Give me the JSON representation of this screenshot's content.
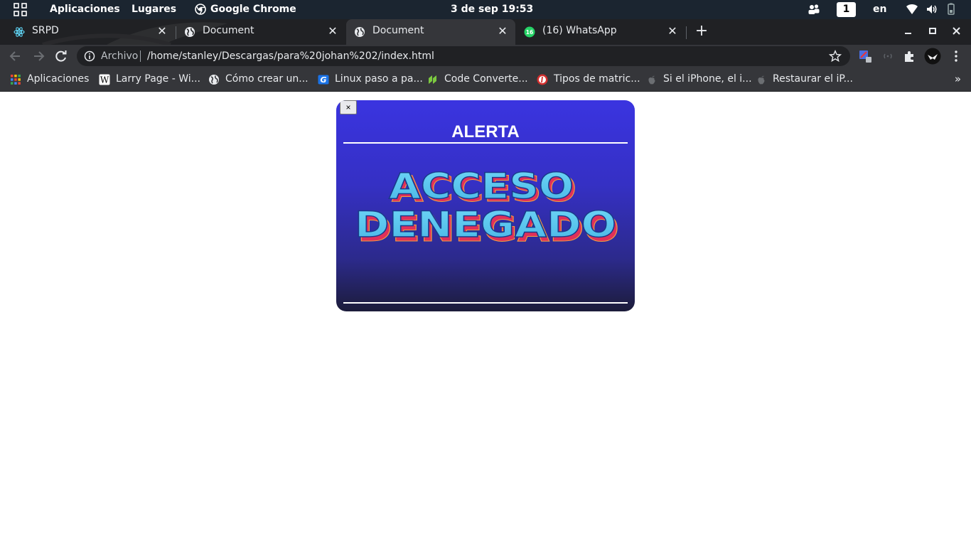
{
  "system_bar": {
    "menus": [
      "Aplicaciones",
      "Lugares",
      "Google Chrome"
    ],
    "clock": "3 de sep  19:53",
    "workspace": "1",
    "keyboard_layout": "en"
  },
  "tabs": [
    {
      "title": "SRPD",
      "icon": "react-icon",
      "active": false
    },
    {
      "title": "Document",
      "icon": "globe-icon",
      "active": false
    },
    {
      "title": "Document",
      "icon": "globe-icon",
      "active": true
    },
    {
      "title": "(16) WhatsApp",
      "icon": "whatsapp-icon",
      "badge": "16",
      "active": false
    }
  ],
  "omnibox": {
    "scheme_label": "Archivo",
    "url": "/home/stanley/Descargas/para%20johan%202/index.html"
  },
  "bookmarks": [
    {
      "label": "Aplicaciones",
      "icon": "apps-grid-icon"
    },
    {
      "label": "Larry Page - Wi...",
      "icon": "wikipedia-icon"
    },
    {
      "label": "Cómo crear un...",
      "icon": "globe-icon"
    },
    {
      "label": "Linux paso a pa...",
      "icon": "linux-site-icon"
    },
    {
      "label": "Code Converte...",
      "icon": "code-converter-icon"
    },
    {
      "label": "Tipos de matric...",
      "icon": "red-site-icon"
    },
    {
      "label": "Si el iPhone, el i...",
      "icon": "apple-icon"
    },
    {
      "label": "Restaurar el iP...",
      "icon": "apple-icon"
    }
  ],
  "modal": {
    "close_label": "×",
    "title": "ALERTA",
    "image_text_line1": "ACCESO",
    "image_text_line2": "DENEGADO"
  },
  "colors": {
    "topbar": "#1b2530",
    "tabstrip": "#202124",
    "toolbar": "#35363a",
    "modal_top": "#3a34e0",
    "modal_bottom": "#1c1c3a",
    "art_fill": "#5ec8f0",
    "art_edge": "#e0305a"
  }
}
